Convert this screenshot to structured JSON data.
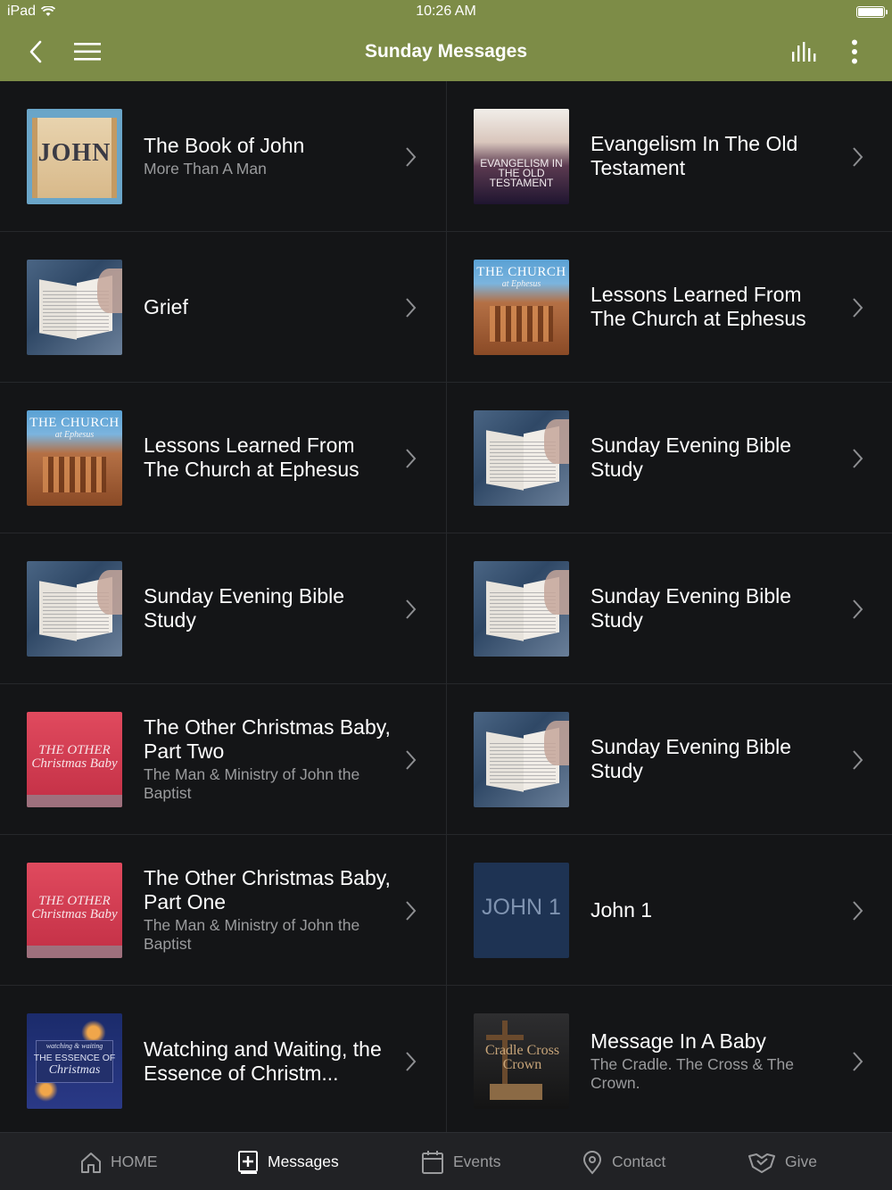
{
  "status_bar": {
    "device": "iPad",
    "time": "10:26 AM"
  },
  "nav": {
    "title": "Sunday Messages"
  },
  "items": [
    {
      "title": "The Book of John",
      "subtitle": "More Than A Man",
      "thumb": "john",
      "thumb_text": "JOHN"
    },
    {
      "title": "Evangelism In The Old Testament",
      "subtitle": "",
      "thumb": "evangelism",
      "thumb_text": "EVANGELISM IN THE OLD TESTAMENT"
    },
    {
      "title": "Grief",
      "subtitle": "",
      "thumb": "bible"
    },
    {
      "title": "Lessons Learned From The Church at Ephesus",
      "subtitle": "",
      "thumb": "church",
      "thumb_text": "THE CHURCH",
      "thumb_sub": "at Ephesus"
    },
    {
      "title": "Lessons Learned From The Church at Ephesus",
      "subtitle": "",
      "thumb": "church",
      "thumb_text": "THE CHURCH",
      "thumb_sub": "at Ephesus"
    },
    {
      "title": "Sunday Evening Bible Study",
      "subtitle": "",
      "thumb": "bible"
    },
    {
      "title": "Sunday Evening Bible Study",
      "subtitle": "",
      "thumb": "bible"
    },
    {
      "title": "Sunday Evening Bible Study",
      "subtitle": "",
      "thumb": "bible"
    },
    {
      "title": "The Other Christmas Baby, Part Two",
      "subtitle": "The Man & Ministry of John the Baptist",
      "thumb": "xmas",
      "thumb_text": "THE OTHER Christmas Baby"
    },
    {
      "title": "Sunday Evening Bible Study",
      "subtitle": "",
      "thumb": "bible"
    },
    {
      "title": "The Other Christmas Baby, Part One",
      "subtitle": "The Man & Ministry of John the Baptist",
      "thumb": "xmas",
      "thumb_text": "THE OTHER Christmas Baby"
    },
    {
      "title": "John 1",
      "subtitle": "",
      "thumb": "john1",
      "thumb_text": "JOHN 1"
    },
    {
      "title": "Watching and Waiting, the Essence of Christm...",
      "subtitle": "",
      "thumb": "watch",
      "thumb_top": "watching & waiting",
      "thumb_text": "THE ESSENCE OF",
      "thumb_sub": "Christmas"
    },
    {
      "title": "Message In A Baby",
      "subtitle": "The Cradle. The Cross & The Crown.",
      "thumb": "cradle",
      "thumb_text": "Cradle Cross Crown"
    }
  ],
  "tabs": [
    {
      "label": "HOME",
      "icon": "home-icon",
      "active": false
    },
    {
      "label": "Messages",
      "icon": "bible-plus-icon",
      "active": true
    },
    {
      "label": "Events",
      "icon": "calendar-icon",
      "active": false
    },
    {
      "label": "Contact",
      "icon": "location-pin-icon",
      "active": false
    },
    {
      "label": "Give",
      "icon": "hand-heart-icon",
      "active": false
    }
  ],
  "colors": {
    "nav_bg": "#7d8c47",
    "list_bg": "#141517",
    "tab_bg": "#212225",
    "subtitle": "#9a9b9d"
  }
}
